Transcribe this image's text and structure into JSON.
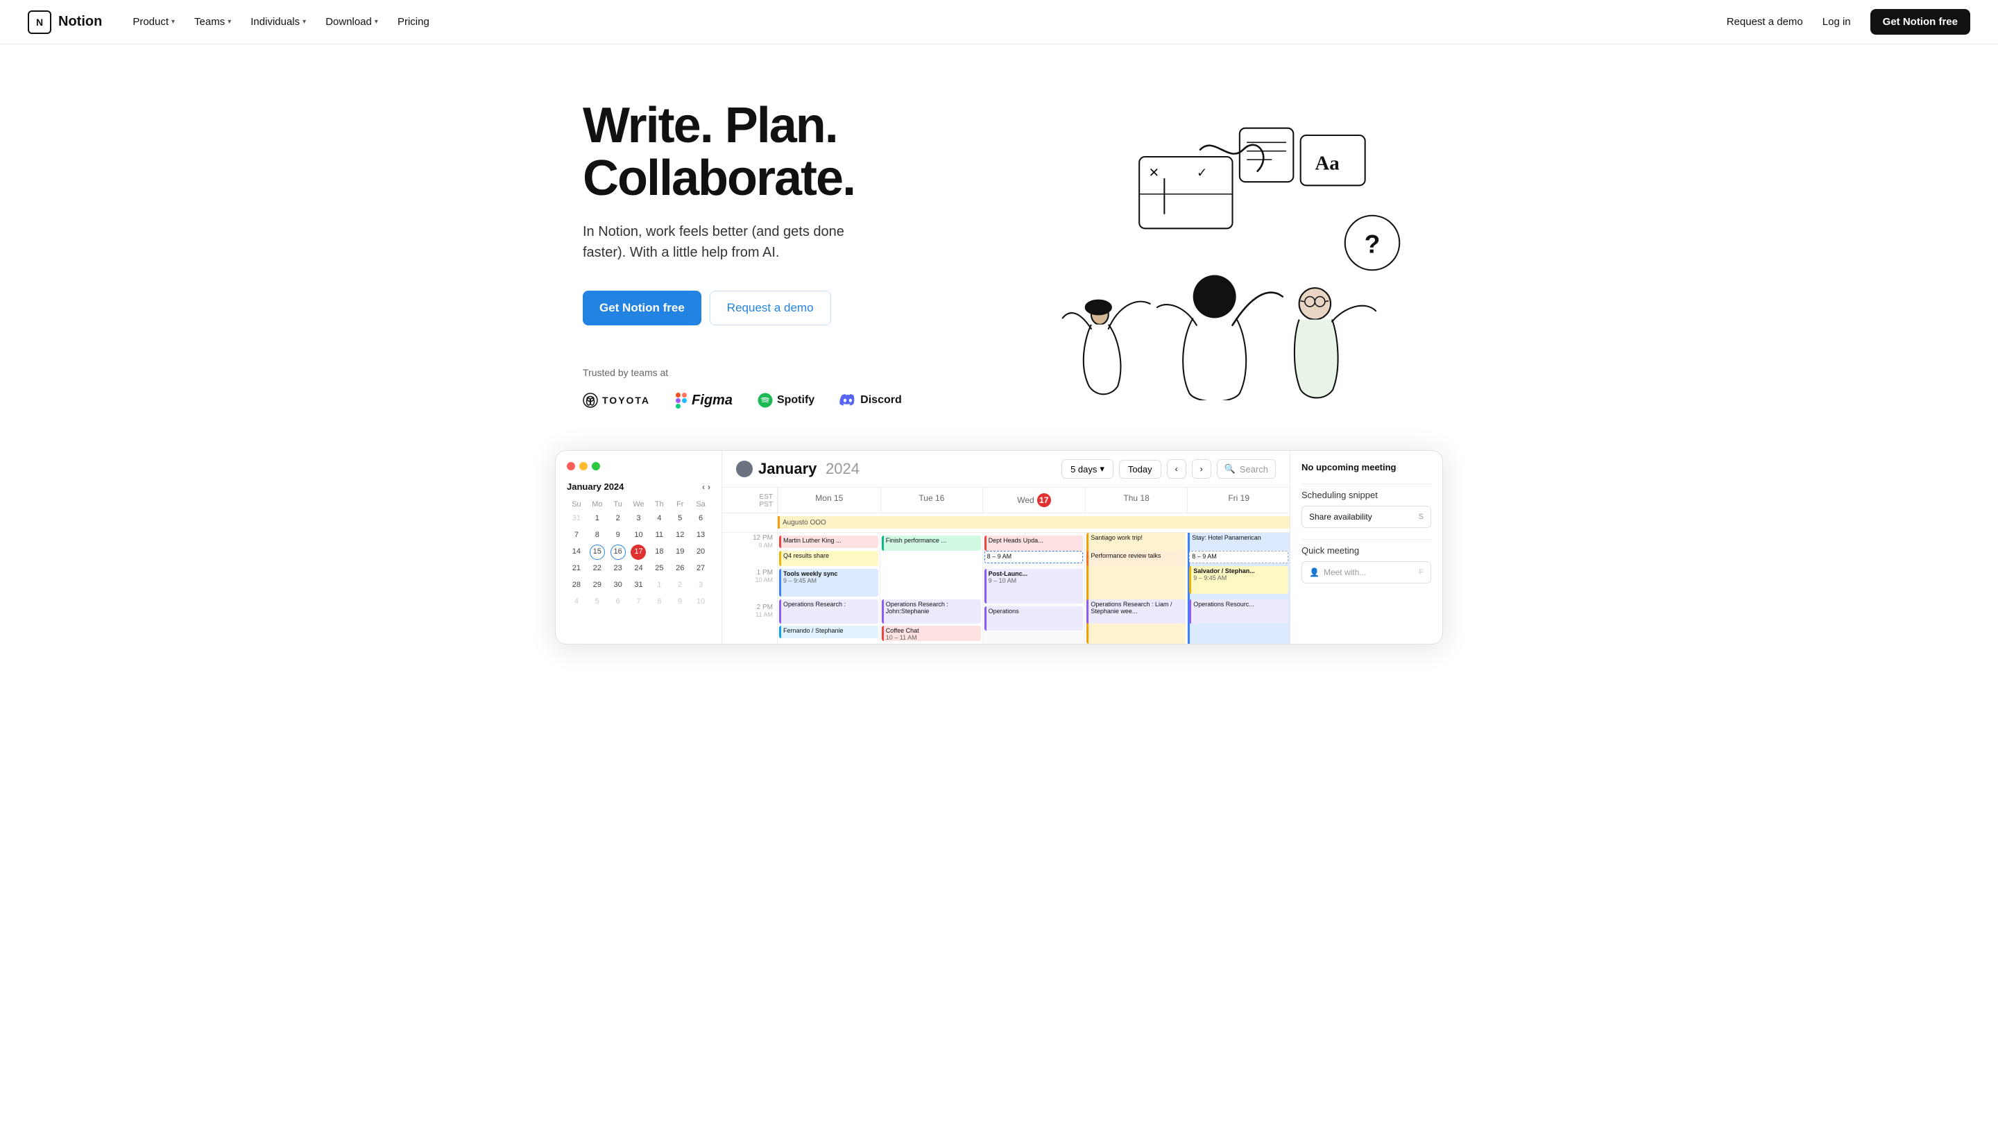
{
  "nav": {
    "logo_text": "Notion",
    "logo_icon": "N",
    "links": [
      {
        "label": "Product",
        "has_chevron": true
      },
      {
        "label": "Teams",
        "has_chevron": true
      },
      {
        "label": "Individuals",
        "has_chevron": true
      },
      {
        "label": "Download",
        "has_chevron": true
      },
      {
        "label": "Pricing",
        "has_chevron": false
      }
    ],
    "request_demo": "Request a demo",
    "login": "Log in",
    "cta": "Get Notion free"
  },
  "hero": {
    "title_line1": "Write. Plan.",
    "title_line2": "Collaborate.",
    "subtitle": "In Notion, work feels better (and gets done faster). With a little help from AI.",
    "btn_primary": "Get Notion free",
    "btn_secondary": "Request a demo",
    "trusted_label": "Trusted by teams at",
    "logos": [
      "TOYOTA",
      "Figma",
      "Spotify",
      "Discord"
    ]
  },
  "calendar": {
    "month": "January",
    "year": "2024",
    "view_label": "5 days",
    "today_btn": "Today",
    "search_placeholder": "Search",
    "days": [
      "Mon 15",
      "Tue 16",
      "Wed 17",
      "Thu 18",
      "Fri 19"
    ],
    "today_index": 2,
    "today_num": "17",
    "mini_cal": {
      "month": "January 2024",
      "headers": [
        "Su",
        "Mo",
        "Tu",
        "We",
        "Th",
        "Fr",
        "Sa"
      ],
      "rows": [
        [
          "31",
          "1",
          "2",
          "3",
          "4",
          "5",
          "6"
        ],
        [
          "7",
          "8",
          "9",
          "10",
          "11",
          "12",
          "13"
        ],
        [
          "14",
          "15",
          "16",
          "17",
          "18",
          "19",
          "20"
        ],
        [
          "21",
          "22",
          "23",
          "24",
          "25",
          "26",
          "27"
        ],
        [
          "28",
          "29",
          "30",
          "31",
          "1",
          "2",
          "3"
        ],
        [
          "4",
          "5",
          "6",
          "7",
          "8",
          "9",
          "10"
        ]
      ],
      "today_cell": "17",
      "other_month_cells": [
        "31",
        "1",
        "2",
        "3"
      ]
    },
    "events": {
      "ooo": "Augusto OOO",
      "stay": "Stay: Hotel Panamerican",
      "mlk": "Martin Luther King ...",
      "finish_perf": "Finish performance ...",
      "dept_heads": "Dept Heads Upda...",
      "santiago": "Santiago work trip!",
      "q4_results": "Q4 results share",
      "perf_talks": "Performance review talks",
      "tools_weekly": "Tools weekly sync",
      "tools_time": "9 – 9:45 AM",
      "ops_research": "Operations Research :",
      "ops_john": "Operations Research : John:Stephanie",
      "coffee": "Coffee Chat",
      "coffee_time": "10 – 11 AM",
      "ops_wed": "Operations",
      "ops_liam": "Operations Research : Liam / Stephanie wee...",
      "ops_fri": "Operations Resourc...",
      "post_launch": "Post-Launc...",
      "post_launch_time": "9 – 10 AM",
      "salvador": "Salvador / Stephan...",
      "salvador_time": "9 – 9:45 AM",
      "fernando": "Fernando / Stephanie",
      "time_8_9": "8 – 9 AM"
    },
    "panel": {
      "no_meeting_label": "No upcoming meeting",
      "scheduling_label": "Scheduling snippet",
      "share_availability": "Share availability",
      "share_key": "S",
      "quick_meeting_label": "Quick meeting",
      "meet_placeholder": "Meet with...",
      "meet_key": "F"
    },
    "times": [
      "EST",
      "PST",
      "12 PM",
      "1 PM",
      "2 PM"
    ],
    "hour_labels": [
      "9 AM",
      "10 AM",
      "11 AM",
      "12 PM"
    ]
  }
}
